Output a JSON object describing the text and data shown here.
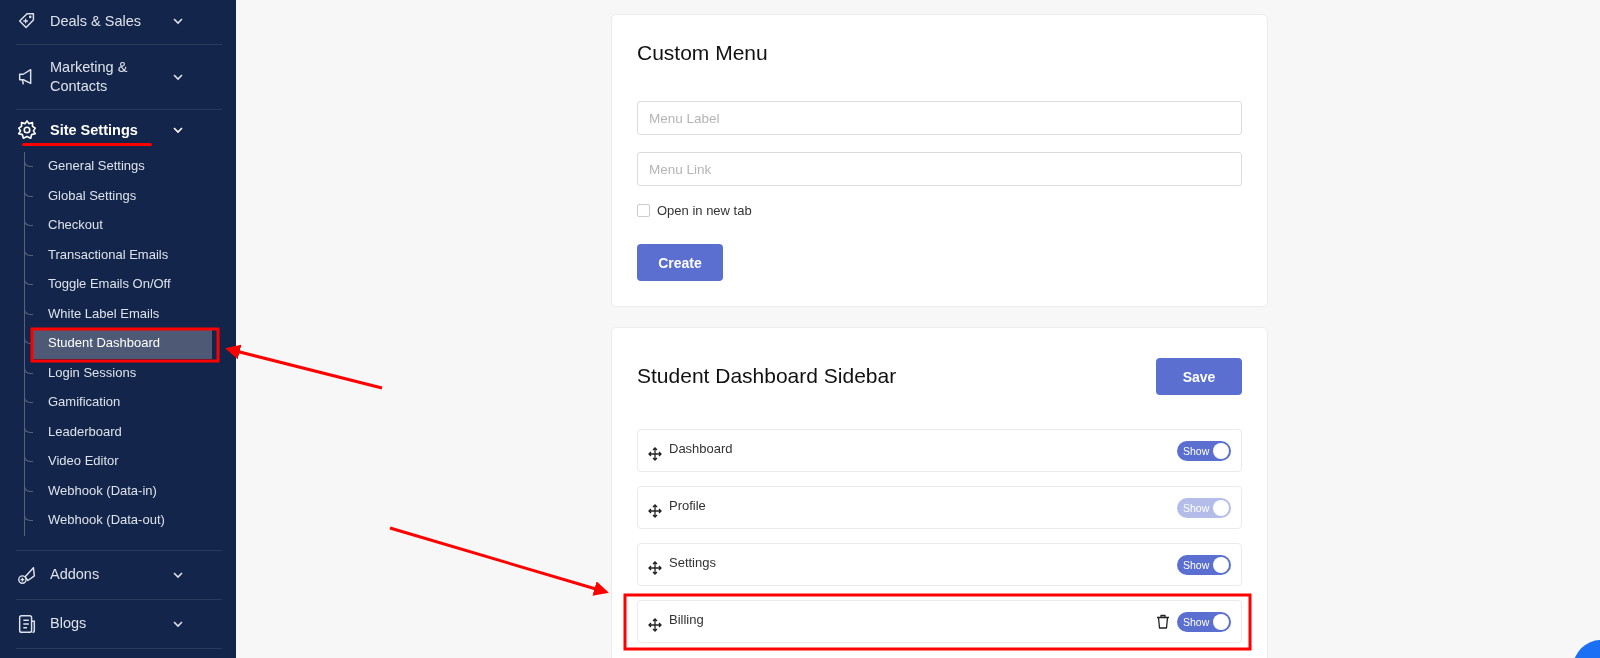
{
  "sidebar": {
    "sections": [
      {
        "label": "Deals & Sales"
      },
      {
        "label": "Marketing & Contacts"
      },
      {
        "label": "Site Settings",
        "selected": true,
        "children": [
          {
            "label": "General Settings",
            "selected": false
          },
          {
            "label": "Global Settings",
            "selected": false
          },
          {
            "label": "Checkout",
            "selected": false
          },
          {
            "label": "Transactional Emails",
            "selected": false
          },
          {
            "label": "Toggle Emails On/Off",
            "selected": false
          },
          {
            "label": "White Label Emails",
            "selected": false
          },
          {
            "label": "Student Dashboard",
            "selected": true
          },
          {
            "label": "Login Sessions",
            "selected": false
          },
          {
            "label": "Gamification",
            "selected": false
          },
          {
            "label": "Leaderboard",
            "selected": false
          },
          {
            "label": "Video Editor",
            "selected": false
          },
          {
            "label": "Webhook (Data-in)",
            "selected": false
          },
          {
            "label": "Webhook (Data-out)",
            "selected": false
          }
        ]
      },
      {
        "label": "Addons"
      },
      {
        "label": "Blogs"
      }
    ]
  },
  "custom_menu": {
    "title": "Custom Menu",
    "fields": [
      {
        "placeholder": "Menu Label"
      },
      {
        "placeholder": "Menu Link"
      }
    ],
    "open_in_new_tab": {
      "label": "Open in new tab",
      "checked": false
    },
    "button": "Create"
  },
  "dashboard_sidebar": {
    "title": "Student Dashboard Sidebar",
    "button": "Save",
    "items": [
      {
        "label": "Dashboard",
        "toggle": "Show",
        "on": true,
        "disabled": false,
        "deletable": false
      },
      {
        "label": "Profile",
        "toggle": "Show",
        "on": true,
        "disabled": true,
        "deletable": false
      },
      {
        "label": "Settings",
        "toggle": "Show",
        "on": true,
        "disabled": false,
        "deletable": false
      },
      {
        "label": "Billing",
        "toggle": "Show",
        "on": true,
        "disabled": false,
        "deletable": true
      }
    ]
  }
}
